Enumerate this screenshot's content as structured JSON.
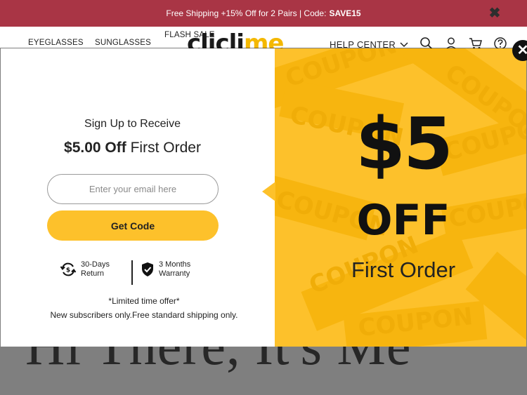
{
  "promo": {
    "text": "Free Shipping +15% Off for 2 Pairs | Code:",
    "code": "SAVE15",
    "close_icon": "close-x-icon"
  },
  "header": {
    "nav": [
      "EYEGLASSES",
      "SUNGLASSES",
      "FLASH SALE"
    ],
    "logo_part1": "clicli",
    "logo_part2": "me",
    "help": "HELP CENTER",
    "icons": [
      "search-icon",
      "user-icon",
      "cart-icon",
      "help-icon"
    ]
  },
  "background": {
    "text": "Hi There, It's Me"
  },
  "modal": {
    "title_line1": "Sign Up to Receive",
    "title_amount": "$5.00 Off",
    "title_rest": " First Order",
    "email_placeholder": "Enter your email here",
    "button": "Get Code",
    "features": [
      {
        "line1": "30-Days",
        "line2": "Return",
        "icon": "return-icon"
      },
      {
        "line1": "3 Months",
        "line2": "Warranty",
        "icon": "shield-check-icon"
      }
    ],
    "limited": "*Limited time offer*",
    "note": "New subscribers only.Free standard shipping only.",
    "promo_big": "$5",
    "promo_off": "OFF",
    "promo_first": "First Order",
    "coupon_word": "COUPON",
    "accent_color": "#fdc12b"
  }
}
